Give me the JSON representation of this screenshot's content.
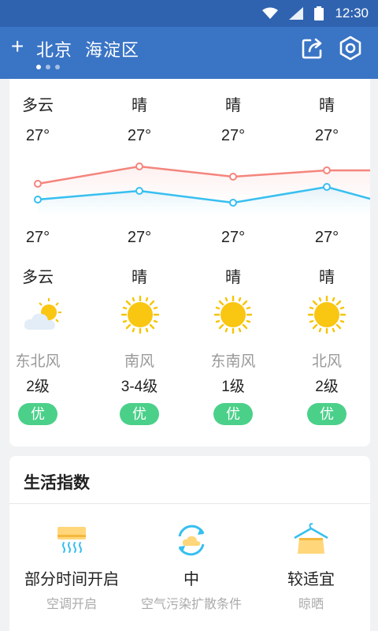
{
  "status": {
    "time": "12:30"
  },
  "header": {
    "add_label": "+",
    "city": "北京",
    "district": "海淀区"
  },
  "forecast": [
    {
      "weather_top": "多云",
      "high": "27°",
      "low": "27°",
      "weather_bottom": "多云",
      "icon": "partly-cloudy-icon",
      "wind_dir": "东北风",
      "wind_level": "2级",
      "aqi": "优"
    },
    {
      "weather_top": "晴",
      "high": "27°",
      "low": "27°",
      "weather_bottom": "晴",
      "icon": "sun-icon",
      "wind_dir": "南风",
      "wind_level": "3-4级",
      "aqi": "优"
    },
    {
      "weather_top": "晴",
      "high": "27°",
      "low": "27°",
      "weather_bottom": "晴",
      "icon": "sun-icon",
      "wind_dir": "东南风",
      "wind_level": "1级",
      "aqi": "优"
    },
    {
      "weather_top": "晴",
      "high": "27°",
      "low": "27°",
      "weather_bottom": "晴",
      "icon": "sun-icon",
      "wind_dir": "北风",
      "wind_level": "2级",
      "aqi": "优"
    }
  ],
  "life_index": {
    "title": "生活指数",
    "items": [
      {
        "main": "部分时间开启",
        "sub": "空调开启",
        "icon": "air-conditioner-icon"
      },
      {
        "main": "中",
        "sub": "空气污染扩散条件",
        "icon": "air-pollution-icon"
      },
      {
        "main": "较适宜",
        "sub": "晾晒",
        "icon": "drying-icon"
      }
    ]
  },
  "colors": {
    "primary": "#3a74c5",
    "high_line": "#f4857d",
    "low_line": "#37bff0",
    "aqi_good": "#4bd08a"
  }
}
